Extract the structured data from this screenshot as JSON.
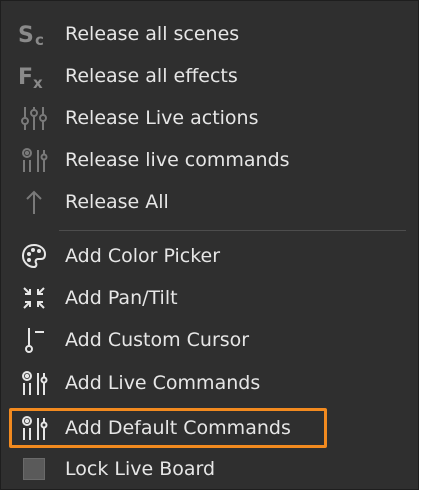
{
  "menu": {
    "items": [
      {
        "label": "Release all scenes",
        "icon": "scenes-icon"
      },
      {
        "label": "Release all effects",
        "icon": "effects-icon"
      },
      {
        "label": "Release Live actions",
        "icon": "live-actions-icon"
      },
      {
        "label": "Release live commands",
        "icon": "live-commands-icon"
      },
      {
        "label": "Release All",
        "icon": "arrow-up-icon"
      },
      {
        "label": "Add Color Picker",
        "icon": "palette-icon"
      },
      {
        "label": "Add Pan/Tilt",
        "icon": "pan-tilt-icon"
      },
      {
        "label": "Add Custom Cursor",
        "icon": "cursor-icon"
      },
      {
        "label": "Add Live Commands",
        "icon": "live-commands-icon"
      },
      {
        "label": "Add Default Commands",
        "icon": "default-commands-icon"
      },
      {
        "label": "Lock Live Board",
        "icon": "checkbox-icon"
      }
    ],
    "colors": {
      "background": "#2f2f2f",
      "text": "#e6e6e6",
      "highlight": "#f28a1f",
      "separator": "#4d4d4d"
    }
  }
}
